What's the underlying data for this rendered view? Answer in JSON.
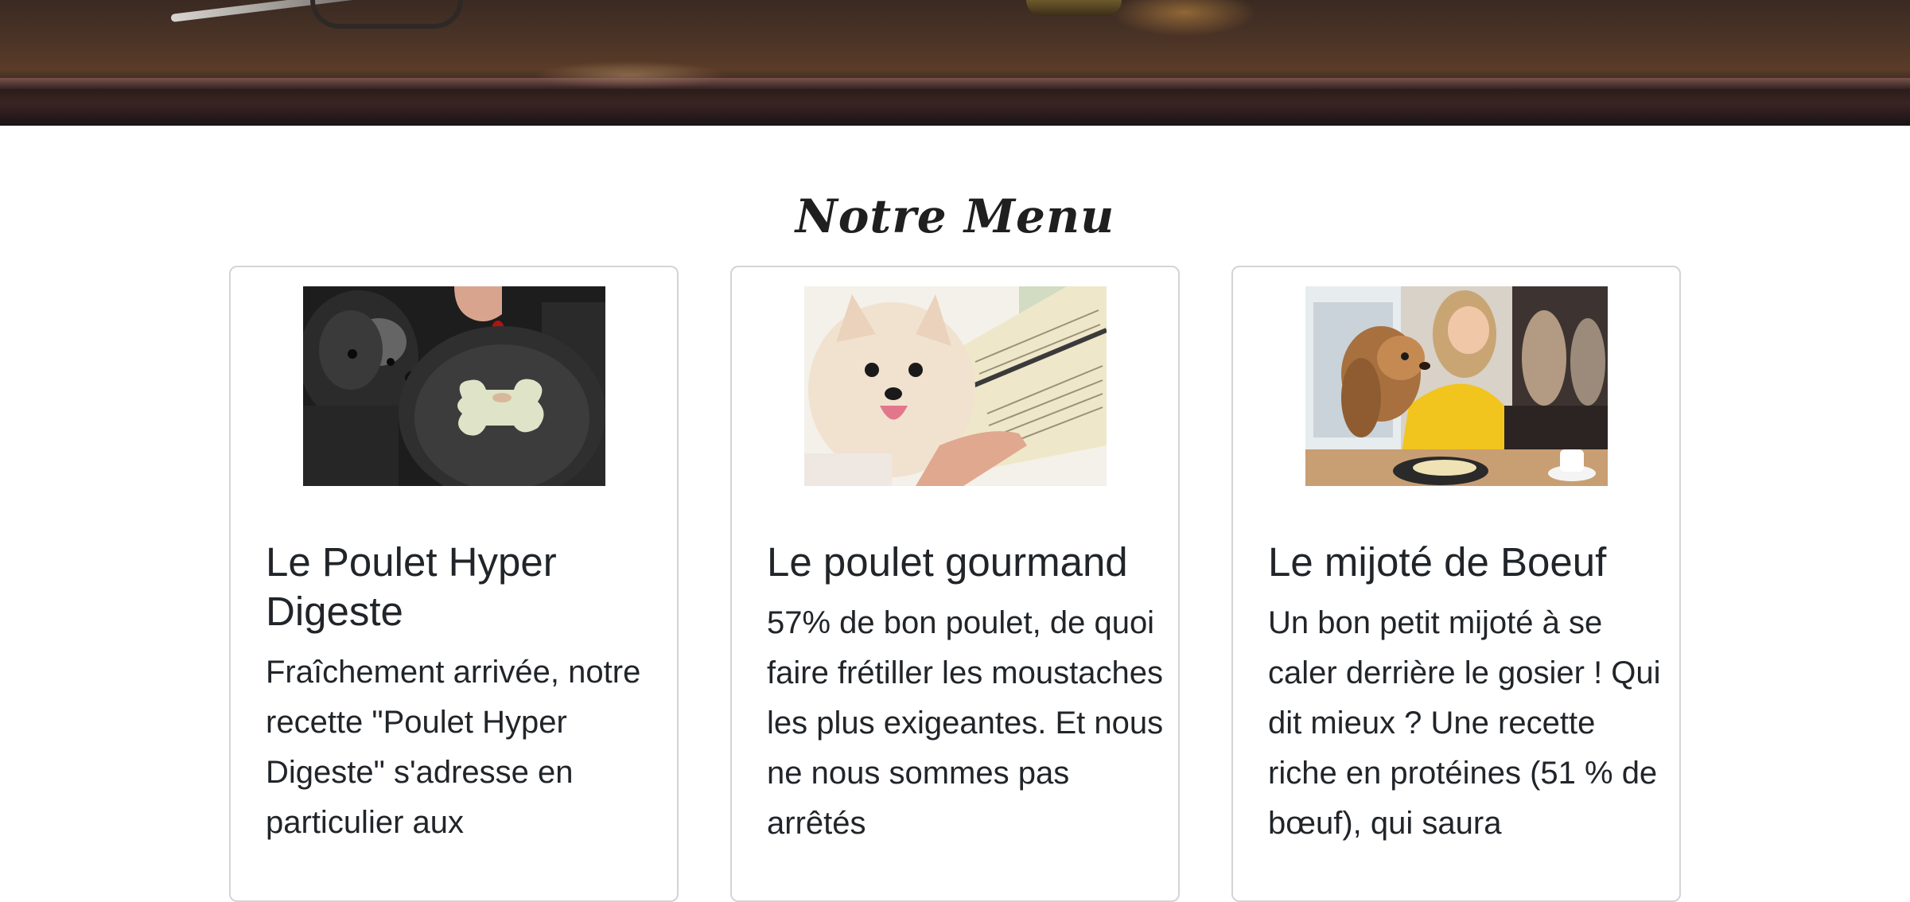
{
  "section": {
    "title": "Notre Menu"
  },
  "cards": [
    {
      "title": "Le Poulet Hyper Digeste",
      "text": "Fraîchement arrivée, notre recette \"Poulet Hyper Digeste\" s'adresse en particulier aux",
      "image_icon": "dog-with-bowl-image"
    },
    {
      "title": "Le poulet gourmand",
      "text": "57% de bon poulet, de quoi faire frétiller les moustaches les plus exigeantes. Et nous ne nous sommes pas arrêtés",
      "image_icon": "dog-reading-menu-image"
    },
    {
      "title": "Le mijoté de Boeuf",
      "text": "Un bon petit mijoté à se caler derrière le gosier ! Qui dit mieux ? Une recette riche en protéines (51 % de bœuf), qui saura",
      "image_icon": "dog-at-restaurant-image"
    }
  ],
  "colors": {
    "text": "#212529",
    "card_border": "#d4d4d4",
    "background": "#ffffff"
  }
}
